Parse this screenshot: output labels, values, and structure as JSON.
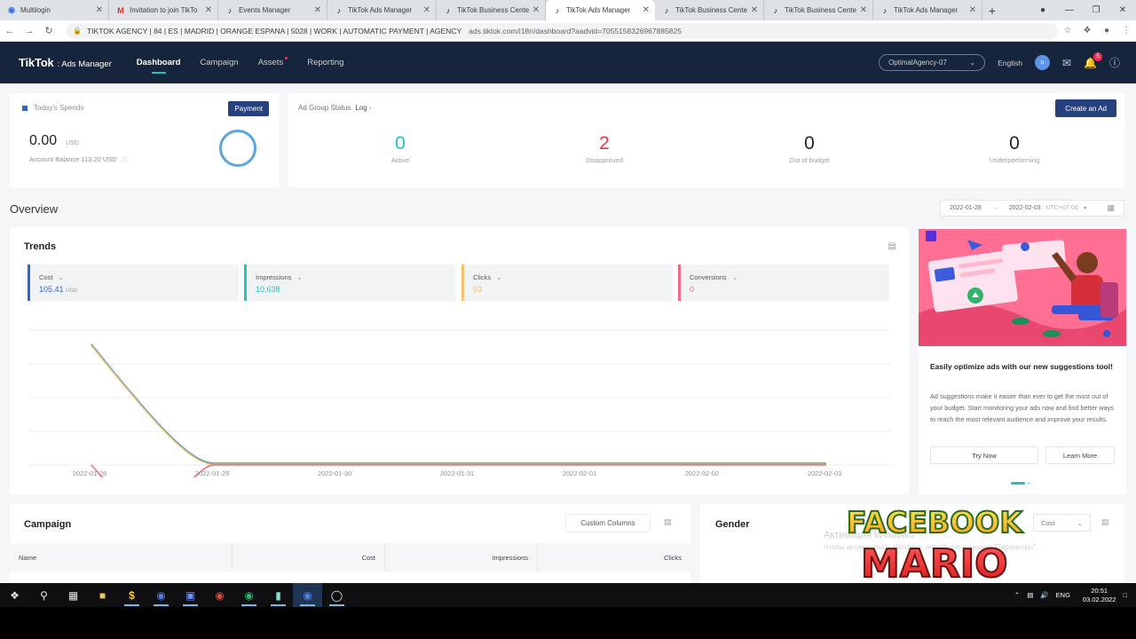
{
  "browser": {
    "tabs": [
      {
        "title": "Multilogin",
        "icon": "multilogin-icon",
        "active": false
      },
      {
        "title": "Invitation to join TikTo",
        "icon": "gmail-icon",
        "active": false
      },
      {
        "title": "Events Manager",
        "icon": "tiktok-icon",
        "active": false
      },
      {
        "title": "TikTok Ads Manager",
        "icon": "tiktok-icon",
        "active": false
      },
      {
        "title": "TikTok Business Center",
        "icon": "tiktok-icon",
        "active": false
      },
      {
        "title": "TikTok Ads Manager",
        "icon": "tiktok-icon",
        "active": true
      },
      {
        "title": "TikTok Business Cente",
        "icon": "tiktok-icon",
        "active": false
      },
      {
        "title": "TikTok Business Cente",
        "icon": "tiktok-icon",
        "active": false
      },
      {
        "title": "TikTok Ads Manager",
        "icon": "tiktok-icon",
        "active": false
      }
    ],
    "profile_label": "TIKTOK AGENCY | 84 | ES | MADRID | ORANGE ESPANA | 5028 | WORK | AUTOMATIC PAYMENT | AGENCY",
    "url": "ads.tiktok.com/i18n/dashboard?aadvid=7055158326967885825"
  },
  "app": {
    "brand": "TikTok",
    "product": ": Ads Manager",
    "nav": [
      "Dashboard",
      "Campaign",
      "Assets",
      "Reporting"
    ],
    "account": "OptimalAgency-07",
    "language": "English",
    "avatar_letter": "u",
    "notification_count": "5"
  },
  "spends": {
    "label": "Today's Spends",
    "payment_label": "Payment",
    "amount": "0.00",
    "currency": "USD",
    "balance": "Account Balance 113.20 USD"
  },
  "status": {
    "title": "Ad Group Status",
    "log_link": "Log",
    "create_label": "Create an Ad",
    "items": [
      {
        "value": "0",
        "label": "Active",
        "color": "#25c2c4"
      },
      {
        "value": "2",
        "label": "Disapproved",
        "color": "#e0394a"
      },
      {
        "value": "0",
        "label": "Out of budget",
        "color": "#222222"
      },
      {
        "value": "0",
        "label": "Underperforming",
        "color": "#222222"
      }
    ]
  },
  "overview": {
    "title": "Overview",
    "date_start": "2022-01-28",
    "date_end": "2022-02-03",
    "timezone": "UTC+07:00"
  },
  "trends": {
    "title": "Trends",
    "metrics": [
      {
        "label": "Cost",
        "value": "105.41",
        "unit": "USD",
        "color": "#2e66d8"
      },
      {
        "label": "Impressions",
        "value": "10,638",
        "unit": "",
        "color": "#25c2c4"
      },
      {
        "label": "Clicks",
        "value": "93",
        "unit": "",
        "color": "#f5c26b"
      },
      {
        "label": "Conversions",
        "value": "0",
        "unit": "",
        "color": "#f0698a"
      }
    ]
  },
  "chart_data": {
    "type": "line",
    "x": [
      "2022-01-28",
      "2022-01-29",
      "2022-01-30",
      "2022-01-31",
      "2022-02-01",
      "2022-02-02",
      "2022-02-03"
    ],
    "series": [
      {
        "name": "Cost",
        "values": [
          105.41,
          0,
          0,
          0,
          0,
          0,
          0
        ],
        "color": "#2e66d8"
      },
      {
        "name": "Impressions",
        "values": [
          10638,
          0,
          0,
          0,
          0,
          0,
          0
        ],
        "color": "#25c2c4"
      },
      {
        "name": "Clicks",
        "values": [
          93,
          0,
          0,
          0,
          0,
          0,
          0
        ],
        "color": "#f5c26b"
      },
      {
        "name": "Conversions",
        "values": [
          0,
          0,
          0,
          0,
          0,
          0,
          0
        ],
        "color": "#f0698a"
      }
    ],
    "grid": true
  },
  "promo": {
    "title": "Easily optimize ads with our new suggestions tool!",
    "body": "Ad suggestions make it easier than ever to get the most out of your budget. Start monitoring your ads now and find better ways to reach the most relevant audience and improve your results.",
    "try_label": "Try Now",
    "learn_label": "Learn More"
  },
  "campaign": {
    "title": "Campaign",
    "custom_columns": "Custom Columns",
    "columns": [
      "Name",
      "Cost",
      "Impressions",
      "Clicks"
    ]
  },
  "gender": {
    "title": "Gender",
    "select": "Cost"
  },
  "activation": {
    "line1": "Активация Windows",
    "line2": "Чтобы активировать Windows, перейдите в раздел \"Параметры\"."
  },
  "watermark": {
    "line1": "FACEBOOK",
    "line2": "MARIO"
  },
  "taskbar": {
    "lang": "ENG",
    "time": "20:51",
    "date": "03.02.2022"
  }
}
